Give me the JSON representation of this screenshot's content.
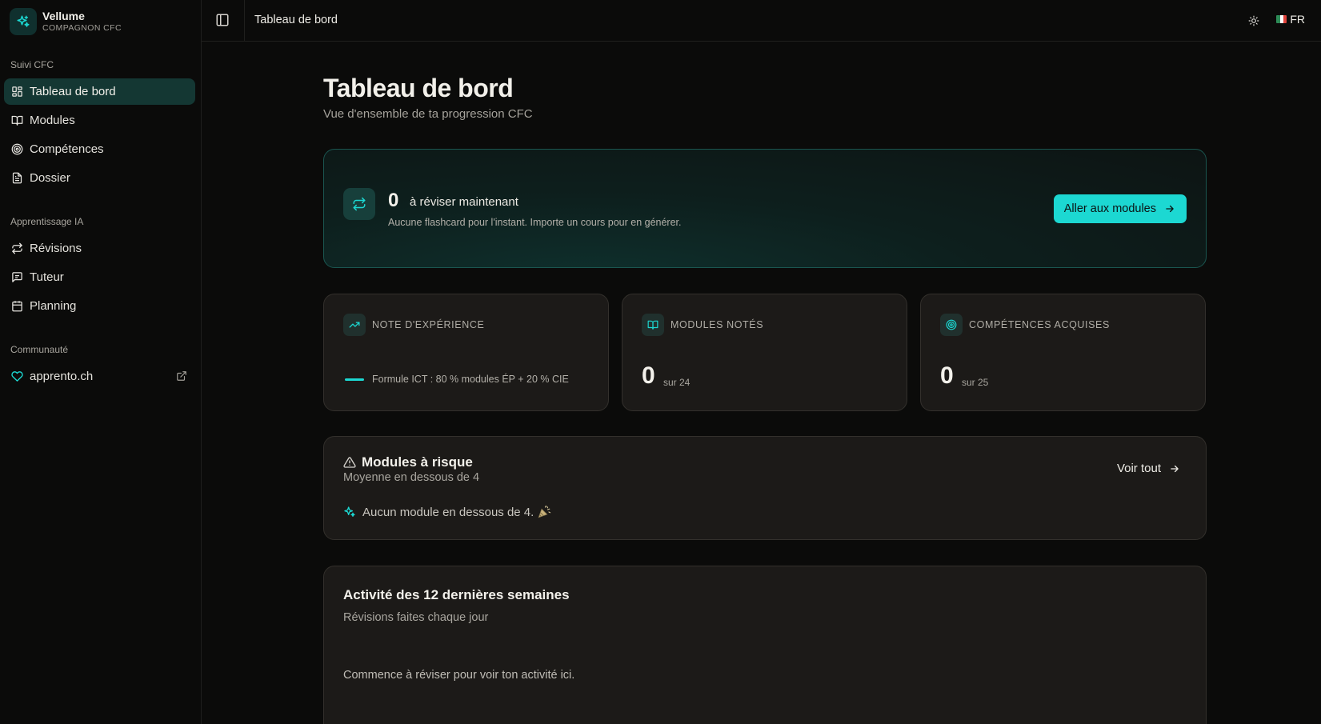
{
  "brand": {
    "name": "Vellume",
    "subtitle": "COMPAGNON CFC"
  },
  "sidebar": {
    "sections": [
      {
        "label": "Suivi CFC"
      },
      {
        "label": "Apprentissage IA"
      },
      {
        "label": "Communauté"
      }
    ],
    "items": [
      {
        "label": "Tableau de bord",
        "icon": "dashboard-icon",
        "active": true
      },
      {
        "label": "Modules",
        "icon": "book-icon"
      },
      {
        "label": "Compétences",
        "icon": "target-icon"
      },
      {
        "label": "Dossier",
        "icon": "file-icon"
      },
      {
        "label": "Révisions",
        "icon": "repeat-icon"
      },
      {
        "label": "Tuteur",
        "icon": "chat-icon"
      },
      {
        "label": "Planning",
        "icon": "calendar-icon"
      },
      {
        "label": "apprento.ch",
        "icon": "heart-icon",
        "external": true
      }
    ]
  },
  "topbar": {
    "title": "Tableau de bord",
    "language": "FR"
  },
  "page": {
    "title": "Tableau de bord",
    "subtitle": "Vue d'ensemble de ta progression CFC"
  },
  "review": {
    "count": "0",
    "label": "à réviser maintenant",
    "hint": "Aucune flashcard pour l'instant. Importe un cours pour en générer.",
    "button": "Aller aux modules"
  },
  "stats": [
    {
      "title": "NOTE D'EXPÉRIENCE",
      "formula": "Formule ICT : 80 % modules ÉP + 20 % CIE",
      "icon": "trending-up-icon"
    },
    {
      "title": "MODULES NOTÉS",
      "value": "0",
      "unit": "sur 24",
      "icon": "book-icon"
    },
    {
      "title": "COMPÉTENCES ACQUISES",
      "value": "0",
      "unit": "sur 25",
      "icon": "target-icon"
    }
  ],
  "risk": {
    "title": "Modules à risque",
    "subtitle": "Moyenne en dessous de 4",
    "link": "Voir tout",
    "empty": "Aucun module en dessous de 4."
  },
  "activity": {
    "title": "Activité des 12 dernières semaines",
    "subtitle": "Révisions faites chaque jour",
    "empty": "Commence à réviser pour voir ton activité ici."
  },
  "colors": {
    "accent": "#1cd8d2",
    "background": "#0b0b0a",
    "card": "#1c1a18",
    "active": "#143733"
  }
}
